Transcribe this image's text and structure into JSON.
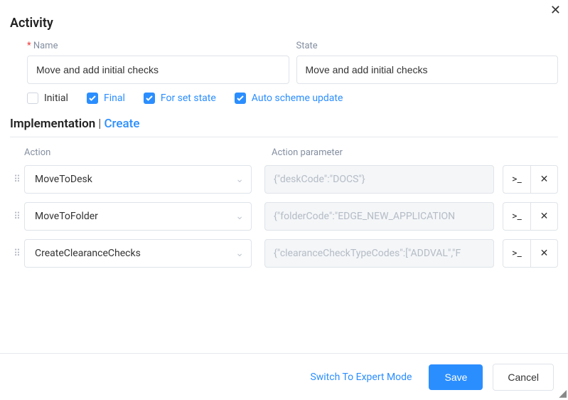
{
  "dialog": {
    "title": "Activity",
    "name_label": "Name",
    "state_label": "State",
    "name_value": "Move and add initial checks",
    "state_value": "Move and add initial checks",
    "checks": {
      "initial": {
        "label": "Initial",
        "checked": false
      },
      "final": {
        "label": "Final",
        "checked": true
      },
      "for_set_state": {
        "label": "For set state",
        "checked": true
      },
      "auto_scheme": {
        "label": "Auto scheme update",
        "checked": true
      }
    }
  },
  "impl": {
    "heading": "Implementation",
    "create_label": "Create",
    "col_action": "Action",
    "col_param": "Action parameter",
    "rows": [
      {
        "action": "MoveToDesk",
        "param": "{\"deskCode\":\"DOCS\"}"
      },
      {
        "action": "MoveToFolder",
        "param": "{\"folderCode\":\"EDGE_NEW_APPLICATION"
      },
      {
        "action": "CreateClearanceChecks",
        "param": "{\"clearanceCheckTypeCodes\":[\"ADDVAL\",\"F"
      }
    ]
  },
  "footer": {
    "expert": "Switch To Expert Mode",
    "save": "Save",
    "cancel": "Cancel"
  }
}
